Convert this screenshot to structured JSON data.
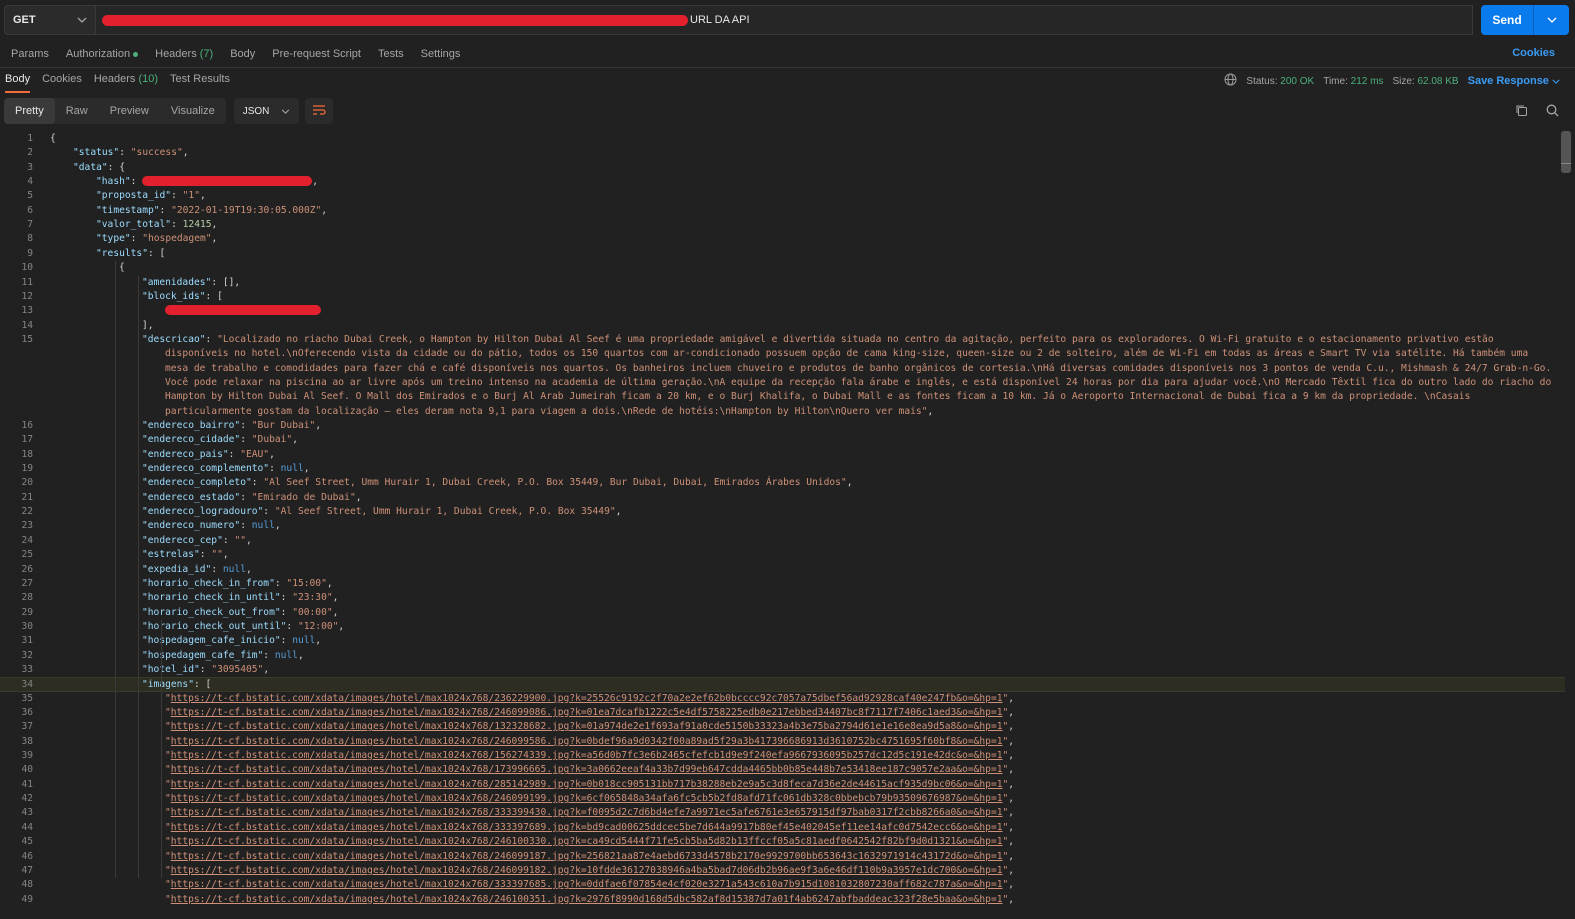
{
  "request": {
    "method": "GET",
    "url_label": "URL DA API",
    "send_label": "Send"
  },
  "request_tabs": [
    {
      "label": "Params"
    },
    {
      "label": "Authorization"
    },
    {
      "label": "Headers",
      "count": "(7)"
    },
    {
      "label": "Body"
    },
    {
      "label": "Pre-request Script"
    },
    {
      "label": "Tests"
    },
    {
      "label": "Settings"
    }
  ],
  "cookies_link": "Cookies",
  "response_tabs": [
    {
      "label": "Body"
    },
    {
      "label": "Cookies"
    },
    {
      "label": "Headers",
      "count": "(10)"
    },
    {
      "label": "Test Results"
    }
  ],
  "status_bar": {
    "status_label": "Status:",
    "status_value": "200 OK",
    "time_label": "Time:",
    "time_value": "212 ms",
    "size_label": "Size:",
    "size_value": "62.08 KB",
    "save_label": "Save Response"
  },
  "view_tabs": [
    "Pretty",
    "Raw",
    "Preview",
    "Visualize"
  ],
  "format": "JSON",
  "code_lines": [
    {
      "n": "1",
      "ind": 0,
      "t": [
        [
          "p",
          "{"
        ]
      ]
    },
    {
      "n": "2",
      "ind": 1,
      "t": [
        [
          "k",
          "\"status\""
        ],
        [
          "p",
          ": "
        ],
        [
          "s",
          "\"success\""
        ],
        [
          "p",
          ","
        ]
      ]
    },
    {
      "n": "3",
      "ind": 1,
      "t": [
        [
          "k",
          "\"data\""
        ],
        [
          "p",
          ": {"
        ]
      ]
    },
    {
      "n": "4",
      "ind": 2,
      "t": [
        [
          "k",
          "\"hash\""
        ],
        [
          "p",
          ": "
        ],
        [
          "r",
          "170"
        ],
        [
          "p",
          ","
        ]
      ]
    },
    {
      "n": "5",
      "ind": 2,
      "t": [
        [
          "k",
          "\"proposta_id\""
        ],
        [
          "p",
          ": "
        ],
        [
          "s",
          "\"1\""
        ],
        [
          "p",
          ","
        ]
      ]
    },
    {
      "n": "6",
      "ind": 2,
      "t": [
        [
          "k",
          "\"timestamp\""
        ],
        [
          "p",
          ": "
        ],
        [
          "s",
          "\"2022-01-19T19:30:05.000Z\""
        ],
        [
          "p",
          ","
        ]
      ]
    },
    {
      "n": "7",
      "ind": 2,
      "t": [
        [
          "k",
          "\"valor_total\""
        ],
        [
          "p",
          ": "
        ],
        [
          "n",
          "12415"
        ],
        [
          "p",
          ","
        ]
      ]
    },
    {
      "n": "8",
      "ind": 2,
      "t": [
        [
          "k",
          "\"type\""
        ],
        [
          "p",
          ": "
        ],
        [
          "s",
          "\"hospedagem\""
        ],
        [
          "p",
          ","
        ]
      ]
    },
    {
      "n": "9",
      "ind": 2,
      "t": [
        [
          "k",
          "\"results\""
        ],
        [
          "p",
          ": ["
        ]
      ]
    },
    {
      "n": "10",
      "ind": 3,
      "t": [
        [
          "p",
          "{"
        ]
      ]
    },
    {
      "n": "11",
      "ind": 4,
      "t": [
        [
          "k",
          "\"amenidades\""
        ],
        [
          "p",
          ": [],"
        ]
      ]
    },
    {
      "n": "12",
      "ind": 4,
      "t": [
        [
          "k",
          "\"block_ids\""
        ],
        [
          "p",
          ": ["
        ]
      ]
    },
    {
      "n": "13",
      "ind": 5,
      "t": [
        [
          "r",
          "156"
        ]
      ]
    },
    {
      "n": "14",
      "ind": 4,
      "t": [
        [
          "p",
          "],"
        ]
      ]
    },
    {
      "n": "15",
      "ind": 4,
      "t": [
        [
          "k",
          "\"descricao\""
        ],
        [
          "p",
          ": "
        ],
        [
          "s",
          "\"Localizado no riacho Dubai Creek, o Hampton by Hilton Dubai Al Seef é uma propriedade amigável e divertida situada no centro da agitação, perfeito para os exploradores. O Wi-Fi gratuito e o estacionamento privativo estão"
        ]
      ]
    },
    {
      "n": "",
      "ind": 5,
      "t": [
        [
          "s",
          "disponíveis no hotel.\\nOferecendo vista da cidade ou do pátio, todos os 150 quartos com ar-condicionado possuem opção de cama king-size, queen-size ou 2 de solteiro, além de Wi-Fi em todas as áreas e Smart TV via satélite. Há também uma"
        ]
      ]
    },
    {
      "n": "",
      "ind": 5,
      "t": [
        [
          "s",
          "mesa de trabalho e comodidades para fazer chá e café disponíveis nos quartos. Os banheiros incluem chuveiro e produtos de banho orgânicos de cortesia.\\nHá diversas comidades disponíveis nos 3 pontos de venda C.u., Mishmash & 24/7 Grab-n-Go."
        ]
      ]
    },
    {
      "n": "",
      "ind": 5,
      "t": [
        [
          "s",
          "Você pode relaxar na piscina ao ar livre após um treino intenso na academia de última geração.\\nA equipe da recepção fala árabe e inglês, e está disponível 24 horas por dia para ajudar você.\\nO Mercado Têxtil fica do outro lado do riacho do"
        ]
      ]
    },
    {
      "n": "",
      "ind": 5,
      "t": [
        [
          "s",
          "Hampton by Hilton Dubai Al Seef. O Mall dos Emirados e o Burj Al Arab Jumeirah ficam a 20 km, e o Burj Khalifa, o Dubai Mall e as fontes ficam a 10 km. Já o Aeroporto Internacional de Dubai fica a 9 km da propriedade. \\nCasais"
        ]
      ]
    },
    {
      "n": "",
      "ind": 5,
      "t": [
        [
          "s",
          "particularmente gostam da localização — eles deram nota 9,1 para viagem a dois.\\nRede de hotéis:\\nHampton by Hilton\\nQuero ver mais\""
        ],
        [
          "p",
          ","
        ]
      ]
    },
    {
      "n": "16",
      "ind": 4,
      "t": [
        [
          "k",
          "\"endereco_bairro\""
        ],
        [
          "p",
          ": "
        ],
        [
          "s",
          "\"Bur Dubai\""
        ],
        [
          "p",
          ","
        ]
      ]
    },
    {
      "n": "17",
      "ind": 4,
      "t": [
        [
          "k",
          "\"endereco_cidade\""
        ],
        [
          "p",
          ": "
        ],
        [
          "s",
          "\"Dubai\""
        ],
        [
          "p",
          ","
        ]
      ]
    },
    {
      "n": "18",
      "ind": 4,
      "t": [
        [
          "k",
          "\"endereco_pais\""
        ],
        [
          "p",
          ": "
        ],
        [
          "s",
          "\"EAU\""
        ],
        [
          "p",
          ","
        ]
      ]
    },
    {
      "n": "19",
      "ind": 4,
      "t": [
        [
          "k",
          "\"endereco_complemento\""
        ],
        [
          "p",
          ": "
        ],
        [
          "nl",
          "null"
        ],
        [
          "p",
          ","
        ]
      ]
    },
    {
      "n": "20",
      "ind": 4,
      "t": [
        [
          "k",
          "\"endereco_completo\""
        ],
        [
          "p",
          ": "
        ],
        [
          "s",
          "\"Al Seef Street, Umm Hurair 1, Dubai Creek, P.O. Box 35449, Bur Dubai, Dubai, Emirados Árabes Unidos\""
        ],
        [
          "p",
          ","
        ]
      ]
    },
    {
      "n": "21",
      "ind": 4,
      "t": [
        [
          "k",
          "\"endereco_estado\""
        ],
        [
          "p",
          ": "
        ],
        [
          "s",
          "\"Emirado de Dubai\""
        ],
        [
          "p",
          ","
        ]
      ]
    },
    {
      "n": "22",
      "ind": 4,
      "t": [
        [
          "k",
          "\"endereco_logradouro\""
        ],
        [
          "p",
          ": "
        ],
        [
          "s",
          "\"Al Seef Street, Umm Hurair 1, Dubai Creek, P.O. Box 35449\""
        ],
        [
          "p",
          ","
        ]
      ]
    },
    {
      "n": "23",
      "ind": 4,
      "t": [
        [
          "k",
          "\"endereco_numero\""
        ],
        [
          "p",
          ": "
        ],
        [
          "nl",
          "null"
        ],
        [
          "p",
          ","
        ]
      ]
    },
    {
      "n": "24",
      "ind": 4,
      "t": [
        [
          "k",
          "\"endereco_cep\""
        ],
        [
          "p",
          ": "
        ],
        [
          "s",
          "\"\""
        ],
        [
          "p",
          ","
        ]
      ]
    },
    {
      "n": "25",
      "ind": 4,
      "t": [
        [
          "k",
          "\"estrelas\""
        ],
        [
          "p",
          ": "
        ],
        [
          "s",
          "\"\""
        ],
        [
          "p",
          ","
        ]
      ]
    },
    {
      "n": "26",
      "ind": 4,
      "t": [
        [
          "k",
          "\"expedia_id\""
        ],
        [
          "p",
          ": "
        ],
        [
          "nl",
          "null"
        ],
        [
          "p",
          ","
        ]
      ]
    },
    {
      "n": "27",
      "ind": 4,
      "t": [
        [
          "k",
          "\"horario_check_in_from\""
        ],
        [
          "p",
          ": "
        ],
        [
          "s",
          "\"15:00\""
        ],
        [
          "p",
          ","
        ]
      ]
    },
    {
      "n": "28",
      "ind": 4,
      "t": [
        [
          "k",
          "\"horario_check_in_until\""
        ],
        [
          "p",
          ": "
        ],
        [
          "s",
          "\"23:30\""
        ],
        [
          "p",
          ","
        ]
      ]
    },
    {
      "n": "29",
      "ind": 4,
      "t": [
        [
          "k",
          "\"horario_check_out_from\""
        ],
        [
          "p",
          ": "
        ],
        [
          "s",
          "\"00:00\""
        ],
        [
          "p",
          ","
        ]
      ]
    },
    {
      "n": "30",
      "ind": 4,
      "t": [
        [
          "k",
          "\"horario_check_out_until\""
        ],
        [
          "p",
          ": "
        ],
        [
          "s",
          "\"12:00\""
        ],
        [
          "p",
          ","
        ]
      ]
    },
    {
      "n": "31",
      "ind": 4,
      "t": [
        [
          "k",
          "\"hospedagem_cafe_inicio\""
        ],
        [
          "p",
          ": "
        ],
        [
          "nl",
          "null"
        ],
        [
          "p",
          ","
        ]
      ]
    },
    {
      "n": "32",
      "ind": 4,
      "t": [
        [
          "k",
          "\"hospedagem_cafe_fim\""
        ],
        [
          "p",
          ": "
        ],
        [
          "nl",
          "null"
        ],
        [
          "p",
          ","
        ]
      ]
    },
    {
      "n": "33",
      "ind": 4,
      "t": [
        [
          "k",
          "\"hotel_id\""
        ],
        [
          "p",
          ": "
        ],
        [
          "s",
          "\"3095405\""
        ],
        [
          "p",
          ","
        ]
      ]
    },
    {
      "n": "34",
      "ind": 4,
      "hl": true,
      "t": [
        [
          "k",
          "\"imagens\""
        ],
        [
          "p",
          ": ["
        ]
      ]
    },
    {
      "n": "35",
      "ind": 5,
      "t": [
        [
          "s",
          "\""
        ],
        [
          "u",
          "https://t-cf.bstatic.com/xdata/images/hotel/max1024x768/236229900.jpg?k=25526c9192c2f70a2e2ef62b0bcccc92c7057a75dbef56ad92928caf40e247fb&o=&hp=1"
        ],
        [
          "s",
          "\""
        ],
        [
          "p",
          ","
        ]
      ]
    },
    {
      "n": "36",
      "ind": 5,
      "t": [
        [
          "s",
          "\""
        ],
        [
          "u",
          "https://t-cf.bstatic.com/xdata/images/hotel/max1024x768/246099086.jpg?k=01ea7dcafb1222c5e4df5758225edb0e217ebbed34407bc8f7117f7406c1aed3&o=&hp=1"
        ],
        [
          "s",
          "\""
        ],
        [
          "p",
          ","
        ]
      ]
    },
    {
      "n": "37",
      "ind": 5,
      "t": [
        [
          "s",
          "\""
        ],
        [
          "u",
          "https://t-cf.bstatic.com/xdata/images/hotel/max1024x768/132328682.jpg?k=01a974de2e1f693af91a0cde5150b33323a4b3e75ba2794d61e1e16e8ea9d5a8&o=&hp=1"
        ],
        [
          "s",
          "\""
        ],
        [
          "p",
          ","
        ]
      ]
    },
    {
      "n": "38",
      "ind": 5,
      "t": [
        [
          "s",
          "\""
        ],
        [
          "u",
          "https://t-cf.bstatic.com/xdata/images/hotel/max1024x768/246099586.jpg?k=0bdef96a9d0342f00a89ad5f29a3b417396686913d3610752bc4751695f60bf8&o=&hp=1"
        ],
        [
          "s",
          "\""
        ],
        [
          "p",
          ","
        ]
      ]
    },
    {
      "n": "39",
      "ind": 5,
      "t": [
        [
          "s",
          "\""
        ],
        [
          "u",
          "https://t-cf.bstatic.com/xdata/images/hotel/max1024x768/156274339.jpg?k=a56d0b7fc3e6b2465cfefcb1d9e9f240efa9667936095b257dc12d5c191e42dc&o=&hp=1"
        ],
        [
          "s",
          "\""
        ],
        [
          "p",
          ","
        ]
      ]
    },
    {
      "n": "40",
      "ind": 5,
      "t": [
        [
          "s",
          "\""
        ],
        [
          "u",
          "https://t-cf.bstatic.com/xdata/images/hotel/max1024x768/173996665.jpg?k=3a0662eeaf4a33b7d99eb647cdda4465bb0b85e448b7e53418ee187c9057e2aa&o=&hp=1"
        ],
        [
          "s",
          "\""
        ],
        [
          "p",
          ","
        ]
      ]
    },
    {
      "n": "41",
      "ind": 5,
      "t": [
        [
          "s",
          "\""
        ],
        [
          "u",
          "https://t-cf.bstatic.com/xdata/images/hotel/max1024x768/285142989.jpg?k=0b018cc905131bb717b38288eb2e9a5c3d8feca7d36e2de44615acf935d9bc06&o=&hp=1"
        ],
        [
          "s",
          "\""
        ],
        [
          "p",
          ","
        ]
      ]
    },
    {
      "n": "42",
      "ind": 5,
      "t": [
        [
          "s",
          "\""
        ],
        [
          "u",
          "https://t-cf.bstatic.com/xdata/images/hotel/max1024x768/246099199.jpg?k=6cf065848a34afa6fc5cb5b2fd8afd71fc061db328c0bbebcb79b93509676987&o=&hp=1"
        ],
        [
          "s",
          "\""
        ],
        [
          "p",
          ","
        ]
      ]
    },
    {
      "n": "43",
      "ind": 5,
      "t": [
        [
          "s",
          "\""
        ],
        [
          "u",
          "https://t-cf.bstatic.com/xdata/images/hotel/max1024x768/333399430.jpg?k=f0095d2c7d6bd4efe7a9971ec5afe6761e3e657915df97bab0317f2cbb8266a0&o=&hp=1"
        ],
        [
          "s",
          "\""
        ],
        [
          "p",
          ","
        ]
      ]
    },
    {
      "n": "44",
      "ind": 5,
      "t": [
        [
          "s",
          "\""
        ],
        [
          "u",
          "https://t-cf.bstatic.com/xdata/images/hotel/max1024x768/333397689.jpg?k=bd9cad00625ddcec5be7d644a9917b80ef45e402045ef11ee14afc0d7542ecc6&o=&hp=1"
        ],
        [
          "s",
          "\""
        ],
        [
          "p",
          ","
        ]
      ]
    },
    {
      "n": "45",
      "ind": 5,
      "t": [
        [
          "s",
          "\""
        ],
        [
          "u",
          "https://t-cf.bstatic.com/xdata/images/hotel/max1024x768/246100330.jpg?k=ca49cd5444f71fe5cb5ba5d82b13ffccf05a5c81aedf0642542f82bf9d0d1321&o=&hp=1"
        ],
        [
          "s",
          "\""
        ],
        [
          "p",
          ","
        ]
      ]
    },
    {
      "n": "46",
      "ind": 5,
      "t": [
        [
          "s",
          "\""
        ],
        [
          "u",
          "https://t-cf.bstatic.com/xdata/images/hotel/max1024x768/246099187.jpg?k=256821aa87e4aebd6733d4578b2170e9929700bb653643c1632971914c43172d&o=&hp=1"
        ],
        [
          "s",
          "\""
        ],
        [
          "p",
          ","
        ]
      ]
    },
    {
      "n": "47",
      "ind": 5,
      "t": [
        [
          "s",
          "\""
        ],
        [
          "u",
          "https://t-cf.bstatic.com/xdata/images/hotel/max1024x768/246099182.jpg?k=10fdde36127038946a4ba5bad7d06db2b96ae9f3a6e46df110b9a3957e1dc700&o=&hp=1"
        ],
        [
          "s",
          "\""
        ],
        [
          "p",
          ","
        ]
      ]
    },
    {
      "n": "48",
      "ind": 5,
      "t": [
        [
          "s",
          "\""
        ],
        [
          "u",
          "https://t-cf.bstatic.com/xdata/images/hotel/max1024x768/333397685.jpg?k=0ddfae6f07854e4cf020e3271a543c610a7b915d1081032807230aff682c787a&o=&hp=1"
        ],
        [
          "s",
          "\""
        ],
        [
          "p",
          ","
        ]
      ]
    },
    {
      "n": "49",
      "ind": 5,
      "t": [
        [
          "s",
          "\""
        ],
        [
          "u",
          "https://t-cf.bstatic.com/xdata/images/hotel/max1024x768/246100351.jpg?k=2976f8990d168d5dbc582af8d15387d7a01f4ab6247abfbaddeac323f28e5baa&o=&hp=1"
        ],
        [
          "s",
          "\""
        ],
        [
          "p",
          ","
        ]
      ]
    }
  ],
  "icons": {
    "method_dropdown": "chevron-down-icon",
    "send_dropdown": "chevron-down-icon",
    "globe": "globe-icon",
    "format_dropdown": "chevron-down-icon",
    "wrap": "wrap-lines-icon",
    "copy": "copy-icon",
    "search": "search-icon"
  }
}
